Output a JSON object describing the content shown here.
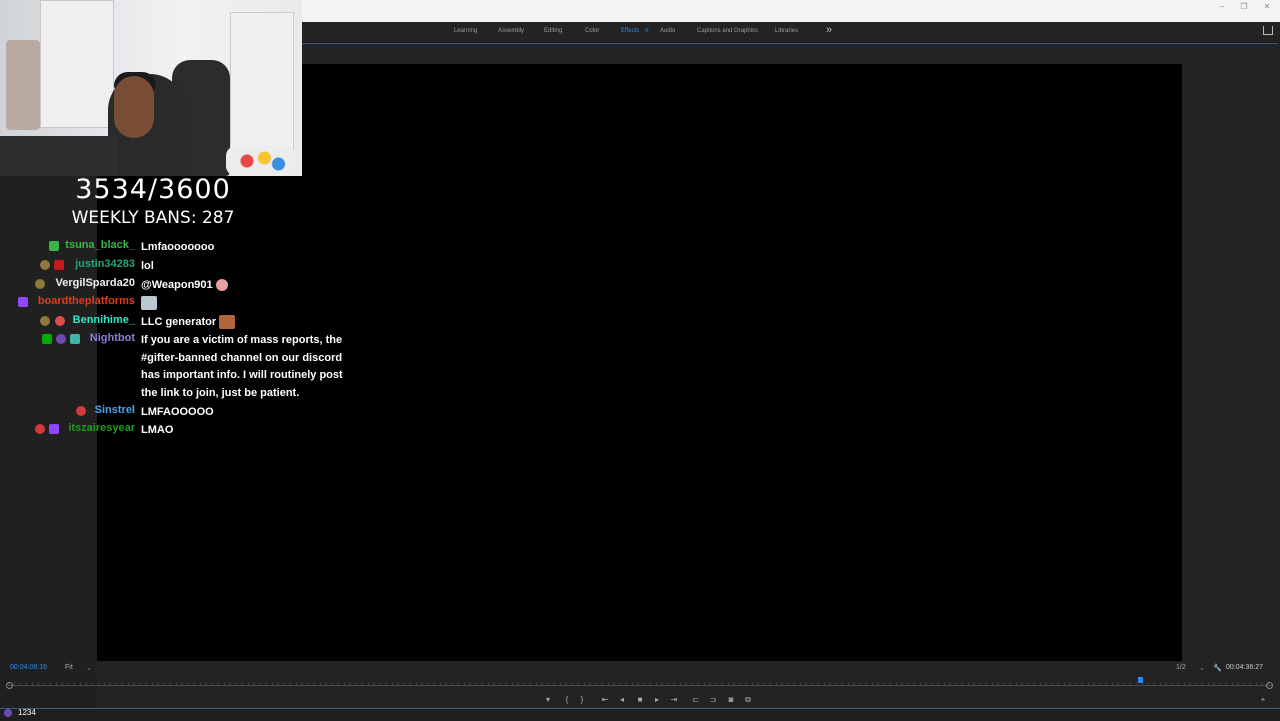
{
  "window_controls": {
    "minimize": "–",
    "restore": "❐",
    "close": "✕"
  },
  "workspaces": [
    {
      "label": "Learning",
      "active": false
    },
    {
      "label": "Assembly",
      "active": false
    },
    {
      "label": "Editing",
      "active": false
    },
    {
      "label": "Color",
      "active": false
    },
    {
      "label": "Effects",
      "active": true
    },
    {
      "label": "Audio",
      "active": false
    },
    {
      "label": "Captions and Graphics",
      "active": false
    },
    {
      "label": "Libraries",
      "active": false
    }
  ],
  "workspace_menu_icon": "≡",
  "workspace_overflow": "»",
  "stream_overlay": {
    "ban_counter": "3534/3600",
    "weekly_bans": "WEEKLY BANS: 287"
  },
  "chat": [
    {
      "user": "tsuna_black_",
      "color": "#39b54a",
      "message": "Lmfaooooooo"
    },
    {
      "user": "justin34283",
      "color": "#1fa67a",
      "message": "lol"
    },
    {
      "user": "VergilSparda20",
      "color": "#f0f0f0",
      "message": "@Weapon901"
    },
    {
      "user": "boardtheplatforms",
      "color": "#e03a1e",
      "message": ""
    },
    {
      "user": "Bennihime_",
      "color": "#2ee6c9",
      "message": "LLC generator"
    },
    {
      "user": "Nightbot",
      "color": "#8a7fd8",
      "message": "If you are a victim of mass reports, the #gifter-banned channel on our discord has important info. I will routinely post the link to join, just be patient."
    },
    {
      "user": "Sinstrel",
      "color": "#4aa3f0",
      "message": "LMFAOOOOO"
    },
    {
      "user": "itszairesyear",
      "color": "#1b9c1b",
      "message": "LMAO"
    }
  ],
  "program_monitor": {
    "timecode_current": "00:04:08:16",
    "fit": "Fit",
    "fit_caret": "⌄",
    "resolution": "1/2",
    "resolution_caret": "⌄",
    "timecode_duration": "00:04:36:27"
  },
  "transport": {
    "marker": "▾",
    "in": "{",
    "out": "}",
    "go_in": "⇤",
    "step_back": "◂",
    "stop": "■",
    "step_forward": "▸",
    "go_out": "⇥",
    "insert": "⊏",
    "overwrite": "⊐",
    "export_frame": "◙",
    "compare": "⧉",
    "add": "+"
  },
  "footer": {
    "counter": "1234"
  },
  "colors": {
    "accent": "#2d8ceb",
    "viewer_bg": "#000000",
    "panel_bg": "#232323"
  }
}
